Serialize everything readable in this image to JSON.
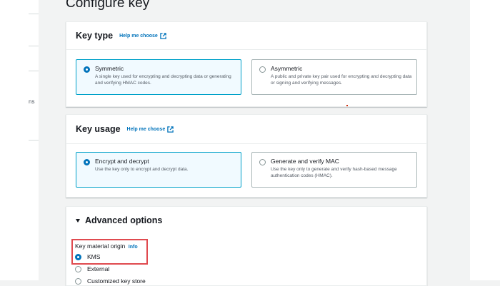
{
  "page": {
    "title": "Configure key"
  },
  "sidebar": {
    "fragment_text": "ns"
  },
  "key_type": {
    "title": "Key type",
    "help_link": "Help me choose",
    "options": [
      {
        "label": "Symmetric",
        "description": "A single key used for encrypting and decrypting data or generating and verifying HMAC codes.",
        "selected": true
      },
      {
        "label": "Asymmetric",
        "description": "A public and private key pair used for encrypting and decrypting data or signing and verifying messages.",
        "selected": false
      }
    ]
  },
  "key_usage": {
    "title": "Key usage",
    "help_link": "Help me choose",
    "options": [
      {
        "label": "Encrypt and decrypt",
        "description": "Use the key only to encrypt and decrypt data.",
        "selected": true
      },
      {
        "label": "Generate and verify MAC",
        "description": "Use the key only to generate and verify hash-based message authentication codes (HMAC).",
        "selected": false
      }
    ]
  },
  "advanced": {
    "title": "Advanced options",
    "key_material_origin": {
      "label": "Key material origin",
      "info": "Info",
      "options": [
        {
          "label": "KMS",
          "selected": true
        },
        {
          "label": "External",
          "selected": false
        },
        {
          "label": "Customized key store",
          "selected": false
        }
      ]
    }
  },
  "colors": {
    "accent": "#0073bb",
    "highlight": "#e04a4f",
    "selected_tile_bg": "#f1faff"
  }
}
